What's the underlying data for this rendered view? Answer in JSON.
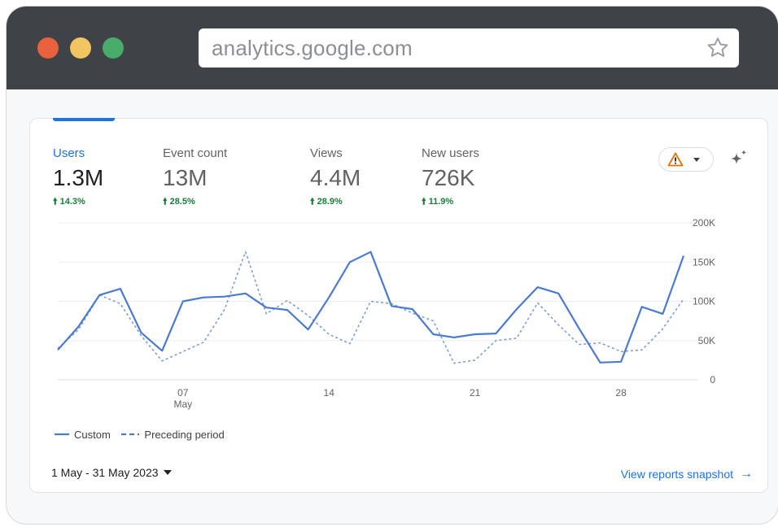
{
  "browser": {
    "url": "analytics.google.com"
  },
  "metrics": [
    {
      "label": "Users",
      "value": "1.3M",
      "change": "14.3%"
    },
    {
      "label": "Event count",
      "value": "13M",
      "change": "28.5%"
    },
    {
      "label": "Views",
      "value": "4.4M",
      "change": "28.9%"
    },
    {
      "label": "New users",
      "value": "726K",
      "change": "11.9%"
    }
  ],
  "controls": {
    "alert_icon": "warning-icon",
    "dropdown_icon": "caret-down-icon",
    "insights_icon": "sparkle-icon"
  },
  "colors": {
    "accent": "#1a73e8",
    "positive": "#188038",
    "warning": "#e37400"
  },
  "legend": {
    "custom": "Custom",
    "preceding": "Preceding period"
  },
  "footer": {
    "date_range": "1 May - 31 May 2023",
    "snapshot_link": "View reports snapshot",
    "arrow": "→"
  },
  "chart_data": {
    "type": "line",
    "x": [
      1,
      2,
      3,
      4,
      5,
      6,
      7,
      8,
      9,
      10,
      11,
      12,
      13,
      14,
      15,
      16,
      17,
      18,
      19,
      20,
      21,
      22,
      23,
      24,
      25,
      26,
      27,
      28,
      29,
      30,
      31
    ],
    "x_ticks": [
      {
        "x": 7,
        "label": "07",
        "sublabel": "May"
      },
      {
        "x": 14,
        "label": "14"
      },
      {
        "x": 21,
        "label": "21"
      },
      {
        "x": 28,
        "label": "28"
      }
    ],
    "y_ticks": [
      "0",
      "50K",
      "100K",
      "150K",
      "200K"
    ],
    "ylim": [
      0,
      200000
    ],
    "grid": true,
    "series": [
      {
        "name": "Custom",
        "style": "solid",
        "values": [
          38000,
          68000,
          108000,
          116000,
          60000,
          37000,
          100000,
          105000,
          106000,
          110000,
          92000,
          89000,
          64000,
          105000,
          150000,
          163000,
          94000,
          90000,
          58000,
          54000,
          58000,
          59000,
          90000,
          118000,
          110000,
          65000,
          22000,
          23000,
          93000,
          84000,
          158000
        ]
      },
      {
        "name": "Preceding period",
        "style": "dashed",
        "values": [
          40000,
          64000,
          108000,
          97000,
          56000,
          24000,
          36000,
          48000,
          90000,
          163000,
          84000,
          101000,
          82000,
          58000,
          46000,
          100000,
          97000,
          85000,
          75000,
          21000,
          25000,
          50000,
          53000,
          98000,
          70000,
          45000,
          47000,
          36000,
          38000,
          65000,
          103000
        ]
      }
    ]
  }
}
